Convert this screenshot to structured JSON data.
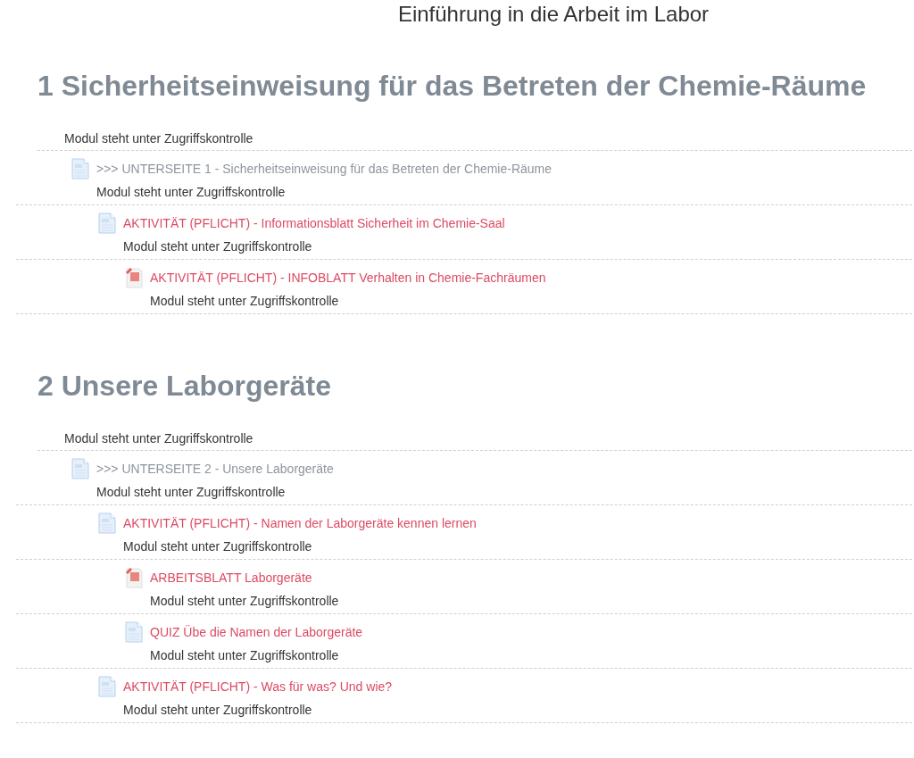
{
  "page_title": "Einführung in die Arbeit im Labor",
  "sections": [
    {
      "title": "1 Sicherheitseinweisung für das Betreten der Chemie-Räume",
      "restriction": "Modul steht unter Zugriffskontrolle",
      "items": [
        {
          "kind": "page",
          "title": ">>> UNTERSEITE 1 - Sicherheitseinweisung für das Betreten der Chemie-Räume",
          "dimmed": true,
          "restriction": "Modul steht unter Zugriffskontrolle",
          "children": [
            {
              "kind": "page",
              "title": "AKTIVITÄT (PFLICHT) - Informationsblatt Sicherheit im Chemie-Saal",
              "dimmed": false,
              "restriction": "Modul steht unter Zugriffskontrolle",
              "children": [
                {
                  "kind": "pdf",
                  "title": "AKTIVITÄT (PFLICHT) - INFOBLATT Verhalten in Chemie-Fachräumen",
                  "dimmed": false,
                  "restriction": "Modul steht unter Zugriffskontrolle"
                }
              ]
            }
          ]
        }
      ]
    },
    {
      "title": "2 Unsere Laborgeräte",
      "restriction": "Modul steht unter Zugriffskontrolle",
      "items": [
        {
          "kind": "page",
          "title": ">>> UNTERSEITE 2 - Unsere Laborgeräte",
          "dimmed": true,
          "restriction": "Modul steht unter Zugriffskontrolle",
          "children": [
            {
              "kind": "page",
              "title": "AKTIVITÄT (PFLICHT) - Namen der Laborgeräte kennen lernen",
              "dimmed": false,
              "restriction": "Modul steht unter Zugriffskontrolle",
              "children": [
                {
                  "kind": "pdf",
                  "title": "ARBEITSBLATT Laborgeräte",
                  "dimmed": false,
                  "restriction": "Modul steht unter Zugriffskontrolle"
                },
                {
                  "kind": "page",
                  "title": "QUIZ Übe die Namen der Laborgeräte",
                  "dimmed": false,
                  "restriction": "Modul steht unter Zugriffskontrolle"
                }
              ]
            },
            {
              "kind": "page",
              "title": "AKTIVITÄT (PFLICHT) - Was für was? Und wie?",
              "dimmed": false,
              "restriction": "Modul steht unter Zugriffskontrolle"
            }
          ]
        }
      ]
    }
  ]
}
